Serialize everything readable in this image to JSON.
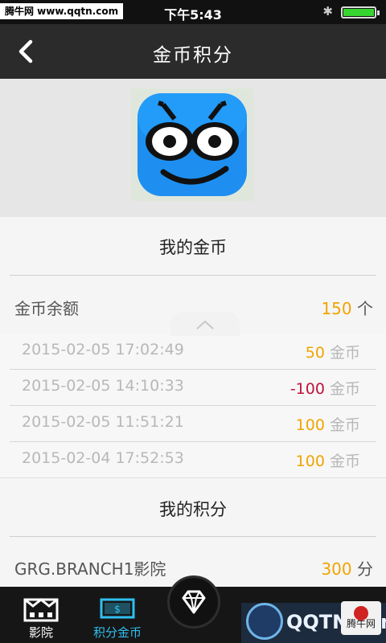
{
  "status": {
    "watermark": "腾牛网 www.qqtn.com",
    "time": "下午5:43",
    "bluetooth_icon": "bluetooth-icon",
    "battery_icon": "battery-icon"
  },
  "nav": {
    "back_icon": "chevron-left-icon",
    "title": "金币积分"
  },
  "hero": {
    "logo_icon": "app-mascot-logo"
  },
  "coins": {
    "title": "我的金币",
    "balance_label": "金币余额",
    "balance_value": "150",
    "balance_unit": "个",
    "history": [
      {
        "time": "2015-02-05 17:02:49",
        "amount": "50",
        "unit": "金币",
        "color": "#f0a500"
      },
      {
        "time": "2015-02-05 14:10:33",
        "amount": "-100",
        "unit": "金币",
        "color": "#c0143c"
      },
      {
        "time": "2015-02-05 11:51:21",
        "amount": "100",
        "unit": "金币",
        "color": "#f0a500"
      },
      {
        "time": "2015-02-04 17:52:53",
        "amount": "100",
        "unit": "金币",
        "color": "#f0a500"
      }
    ]
  },
  "points": {
    "title": "我的积分",
    "cinema_label": "GRG.BRANCH1影院",
    "points_value": "300",
    "points_unit": "分"
  },
  "tabbar": {
    "tabs": [
      {
        "label": "影院",
        "icon": "cinema-icon",
        "active": false
      },
      {
        "label": "积分金币",
        "icon": "money-icon",
        "active": true
      }
    ],
    "center_icon": "diamond-icon"
  },
  "footer_watermark": {
    "text": "QQTN.com",
    "badge": "腾牛网"
  }
}
